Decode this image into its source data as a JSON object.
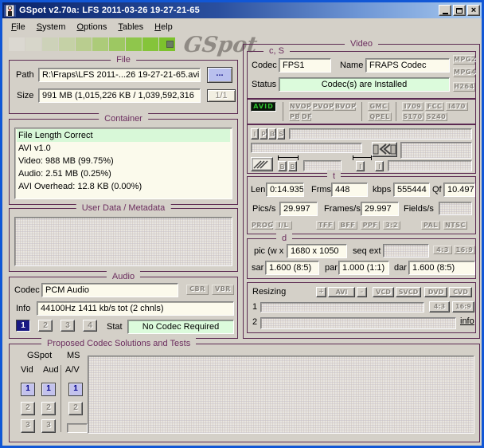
{
  "window": {
    "title": "GSpot v2.70a: LFS 2011-03-26 19-27-21-65"
  },
  "menu": {
    "items": [
      "File",
      "System",
      "Options",
      "Tables",
      "Help"
    ]
  },
  "logo_text": "GSpot",
  "file": {
    "caption": "File",
    "path_label": "Path",
    "path_value": "R:\\Fraps\\LFS 2011-...26 19-27-21-65.avi",
    "browse_label": "...",
    "size_label": "Size",
    "size_value": "991 MB (1,015,226 KB / 1,039,592,316",
    "page_label": "1/1"
  },
  "container": {
    "caption": "Container",
    "lines": [
      "File Length Correct",
      "AVI v1.0",
      "Video: 988 MB (99.75%)",
      "Audio: 2.51 MB (0.25%)",
      "AVI Overhead: 12.8 KB (0.00%)"
    ]
  },
  "user_data": {
    "caption": "User Data / Metadata"
  },
  "audio": {
    "caption": "Audio",
    "codec_label": "Codec",
    "codec_value": "PCM Audio",
    "cbr": "CBR",
    "vbr": "VBR",
    "info_label": "Info",
    "info_value": "44100Hz  1411 kb/s tot (2 chnls)",
    "buttons": [
      "1",
      "2",
      "3",
      "4"
    ],
    "stat_label": "Stat",
    "stat_value": "No Codec Required"
  },
  "video": {
    "caption": "Video",
    "cs": {
      "caption": "c, S",
      "codec_label": "Codec",
      "codec_value": "FPS1",
      "name_label": "Name",
      "name_value": "FRAPS Codec",
      "status_label": "Status",
      "status_value": "Codec(s) are Installed",
      "mpg2": "MPG2",
      "mpg4": "MPG4",
      "h264": "H264"
    },
    "flags": {
      "avid": "AVID",
      "nvop": "NVOP",
      "pvop": "PVOP",
      "bvop": "BVOP",
      "gmc": "GMC",
      "i709": "I709",
      "fcc": "FCC",
      "i470": "I470",
      "pb": "PB",
      "df": "DF",
      "qpel": "QPEL",
      "s170": "S170",
      "s240": "S240"
    },
    "ipbs": [
      "I",
      "P",
      "B",
      "S"
    ],
    "b_btns": [
      "B",
      "B"
    ],
    "i_btns": [
      "I",
      "I"
    ],
    "t": {
      "caption": "t",
      "len_label": "Len",
      "len_value": "0:14.935",
      "frms_label": "Frms",
      "frms_value": "448",
      "kbps_label": "kbps",
      "kbps_value": "555444",
      "qf_label": "Qf",
      "qf_value": "10.497",
      "pics_label": "Pics/s",
      "pics_value": "29.997",
      "frames_label": "Frames/s",
      "frames_value": "29.997",
      "fields_label": "Fields/s",
      "prog": "PROG",
      "il": "I/L",
      "tff": "TFF",
      "bff": "BFF",
      "ppf": "PPF",
      "pulldown": "3:2",
      "pal": "PAL",
      "ntsc": "NTSC"
    },
    "d": {
      "caption": "d",
      "pic_label": "pic (w x",
      "pic_value": "1680 x 1050",
      "seq_label": "seq ext",
      "ar43": "4:3",
      "ar169": "16:9",
      "sar_label": "sar",
      "sar_value": "1.600 (8:5)",
      "par_label": "par",
      "par_value": "1.000 (1:1)",
      "dar_label": "dar",
      "dar_value": "1.600 (8:5)"
    },
    "resizing": {
      "label": "Resizing",
      "plus": "+",
      "avi": "AVI",
      "minus": "-",
      "vcd": "VCD",
      "svcd": "SVCD",
      "dvd": "DVD",
      "cvd": "CVD",
      "row1_label": "1",
      "ar43": "4:3",
      "ar169": "16:9",
      "row2_label": "2",
      "info_link": "info"
    }
  },
  "proposed": {
    "caption": "Proposed Codec Solutions and Tests",
    "gspot_label": "GSpot",
    "vid_label": "Vid",
    "aud_label": "Aud",
    "ms_label": "MS",
    "av_label": "A/V",
    "vid_buttons": [
      "1",
      "2",
      "3"
    ],
    "aud_buttons": [
      "1",
      "2",
      "3"
    ],
    "ms_buttons": [
      "1",
      "2"
    ]
  },
  "colors": {
    "group_border": "#5c2a52",
    "caption_text": "#6b2d5e",
    "field_bg": "#fcfaec",
    "status_green": "#dcfbdc",
    "active_green_led": "#2fbf2f",
    "titlebar_left": "#0a246a",
    "titlebar_right": "#a9caef",
    "progress_green": "#7cc22c"
  }
}
